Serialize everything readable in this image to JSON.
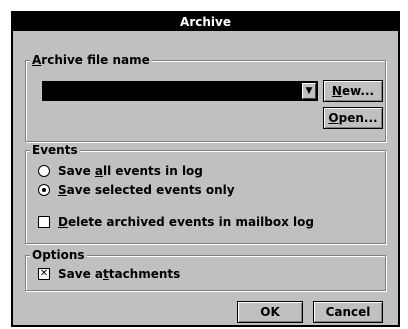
{
  "window": {
    "title": "Archive"
  },
  "archive_file": {
    "group_label_underlined": "A",
    "group_label_rest": "rchive file name",
    "combo_value": "",
    "combo_arrow": "▼",
    "new_button_underlined": "N",
    "new_button_rest": "ew...",
    "open_button_underlined": "O",
    "open_button_rest": "pen..."
  },
  "events": {
    "group_label": "Events",
    "options": [
      {
        "prefix": "Save ",
        "underlined": "a",
        "suffix": "ll events in log",
        "selected": false
      },
      {
        "prefix": "",
        "underlined": "S",
        "suffix": "ave selected events only",
        "selected": true
      }
    ],
    "delete_archived": {
      "underlined": "D",
      "rest": "elete archived events in mailbox log",
      "checked": false
    }
  },
  "options": {
    "group_label": "Options",
    "save_attachments": {
      "prefix": "Save a",
      "underlined": "t",
      "suffix": "tachments",
      "checked": true,
      "check_mark": "✕"
    }
  },
  "buttons": {
    "ok": "OK",
    "cancel": "Cancel"
  }
}
